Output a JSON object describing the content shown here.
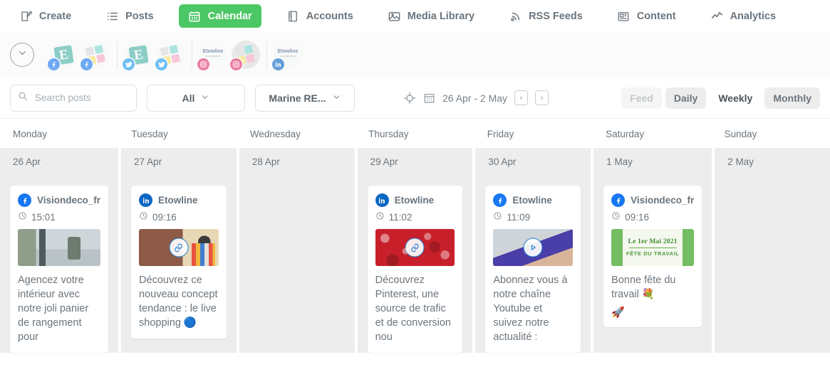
{
  "nav": {
    "items": [
      {
        "label": "Create",
        "icon": "pencil-square-icon",
        "active": false
      },
      {
        "label": "Posts",
        "icon": "list-icon",
        "active": false
      },
      {
        "label": "Calendar",
        "icon": "calendar-icon",
        "active": true
      },
      {
        "label": "Accounts",
        "icon": "book-icon",
        "active": false
      },
      {
        "label": "Media Library",
        "icon": "image-stack-icon",
        "active": false
      },
      {
        "label": "RSS Feeds",
        "icon": "rss-icon",
        "active": false
      },
      {
        "label": "Content",
        "icon": "newspaper-icon",
        "active": false
      },
      {
        "label": "Analytics",
        "icon": "trend-line-icon",
        "active": false
      }
    ],
    "accent_color": "#4cc766"
  },
  "accounts_bar": {
    "collapse_icon": "chevron-down-icon",
    "groups": [
      {
        "network": "facebook",
        "badge_color": "#1877f2",
        "avatars": [
          {
            "name": "Etowline",
            "art": "etowline-logo"
          },
          {
            "name": "Visiondeco_fr",
            "art": "visiondeco-logo"
          }
        ]
      },
      {
        "network": "twitter",
        "badge_color": "#1d9bf0",
        "avatars": [
          {
            "name": "Etowline",
            "art": "etowline-logo"
          },
          {
            "name": "Visiondeco_fr",
            "art": "visiondeco-logo"
          }
        ]
      },
      {
        "network": "instagram",
        "badge_color": "#e1306c",
        "avatars": [
          {
            "name": "Etowline",
            "art": "etowline-text-logo"
          },
          {
            "name": "Visiondeco_fr",
            "art": "visiondeco-logo",
            "dimmed": true
          }
        ]
      },
      {
        "network": "linkedin",
        "badge_color": "#0a66c2",
        "avatars": [
          {
            "name": "Etowline",
            "art": "etowline-text-logo"
          }
        ]
      }
    ]
  },
  "filters": {
    "search": {
      "placeholder": "Search posts",
      "value": "",
      "icon": "search-icon"
    },
    "type_select": {
      "value": "All",
      "icon": "chevron-down-icon"
    },
    "profile_select": {
      "value": "Marine RE...",
      "icon": "chevron-down-icon"
    },
    "target_icon": "crosshair-icon",
    "calendar_icon": "calendar-icon",
    "date_range": "26 Apr - 2 May",
    "prev_label": "‹",
    "next_label": "›",
    "views": [
      {
        "label": "Feed",
        "state": "disabled"
      },
      {
        "label": "Daily",
        "state": "normal"
      },
      {
        "label": "Weekly",
        "state": "active"
      },
      {
        "label": "Monthly",
        "state": "normal"
      }
    ]
  },
  "calendar": {
    "columns": [
      {
        "weekday": "Monday",
        "date": "26 Apr",
        "posts": [
          {
            "network": "facebook",
            "network_icon": "facebook-icon",
            "account": "Visiondeco_fr",
            "time": "15:01",
            "clock_icon": "clock-icon",
            "thumb": "interior-shelf-photo",
            "overlay": "none",
            "text": "Agencez votre intérieur avec notre joli panier de rangement pour"
          }
        ]
      },
      {
        "weekday": "Tuesday",
        "date": "27 Apr",
        "posts": [
          {
            "network": "linkedin",
            "network_icon": "linkedin-icon",
            "account": "Etowline",
            "time": "09:16",
            "clock_icon": "clock-icon",
            "thumb": "live-shopping-photo",
            "overlay": "link-icon",
            "text": "Découvrez ce nouveau concept tendance : le live shopping 🔵"
          }
        ]
      },
      {
        "weekday": "Wednesday",
        "date": "28 Apr",
        "posts": []
      },
      {
        "weekday": "Thursday",
        "date": "29 Apr",
        "posts": [
          {
            "network": "linkedin",
            "network_icon": "linkedin-icon",
            "account": "Etowline",
            "time": "11:02",
            "clock_icon": "clock-icon",
            "thumb": "pinterest-logos-photo",
            "overlay": "link-icon",
            "text": "Découvrez Pinterest, une source de trafic et de conversion nou"
          }
        ]
      },
      {
        "weekday": "Friday",
        "date": "30 Apr",
        "posts": [
          {
            "network": "facebook",
            "network_icon": "facebook-icon",
            "account": "Etowline",
            "time": "11:09",
            "clock_icon": "clock-icon",
            "thumb": "video-thumbnail",
            "overlay": "play-icon",
            "text": "Abonnez vous à notre chaîne Youtube et suivez notre actualité :"
          }
        ]
      },
      {
        "weekday": "Saturday",
        "date": "1 May",
        "posts": [
          {
            "network": "facebook",
            "network_icon": "facebook-icon",
            "account": "Visiondeco_fr",
            "time": "09:16",
            "clock_icon": "clock-icon",
            "thumb": "may-day-banner",
            "thumb_title": "Le 1er Mai 2021",
            "thumb_subtitle": "FÊTE DU TRAVAIL",
            "overlay": "none",
            "text": "Bonne fête du travail 💐",
            "extra": "🚀"
          }
        ]
      },
      {
        "weekday": "Sunday",
        "date": "2 May",
        "posts": []
      }
    ]
  }
}
